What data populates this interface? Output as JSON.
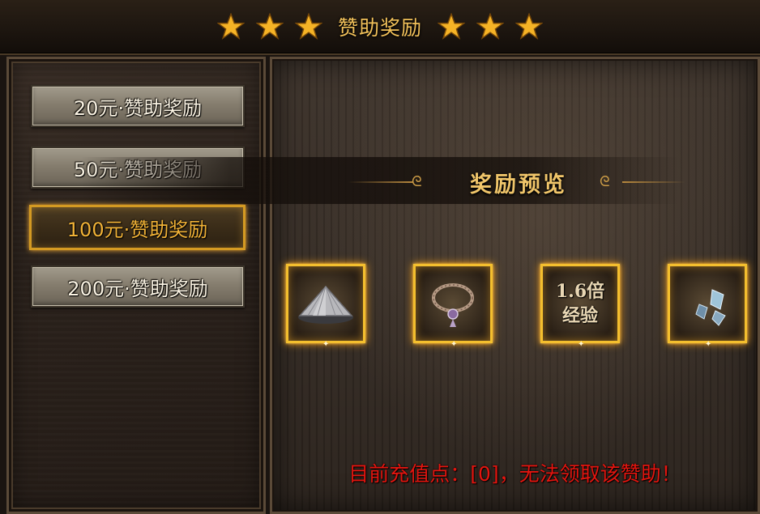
{
  "title": "赞助奖励",
  "tiers": [
    {
      "label": "20元·赞助奖励"
    },
    {
      "label": "50元·赞助奖励"
    },
    {
      "label": "100元·赞助奖励"
    },
    {
      "label": "200元·赞助奖励"
    }
  ],
  "selected_tier_index": 2,
  "preview": {
    "title": "奖励预览",
    "items": [
      {
        "icon": "bamboo-hat-icon"
      },
      {
        "icon": "necklace-icon"
      },
      {
        "icon": "exp-multiplier",
        "line1": "1.6倍",
        "line2": "经验"
      },
      {
        "icon": "crystal-shards-icon"
      }
    ]
  },
  "status_text": "目前充值点：[0]，无法领取该赞助！",
  "colors": {
    "title_gold": "#f2c15a",
    "active_border": "#d49a22",
    "status_red": "#e3150f",
    "slot_glow": "#f4bf2e"
  }
}
